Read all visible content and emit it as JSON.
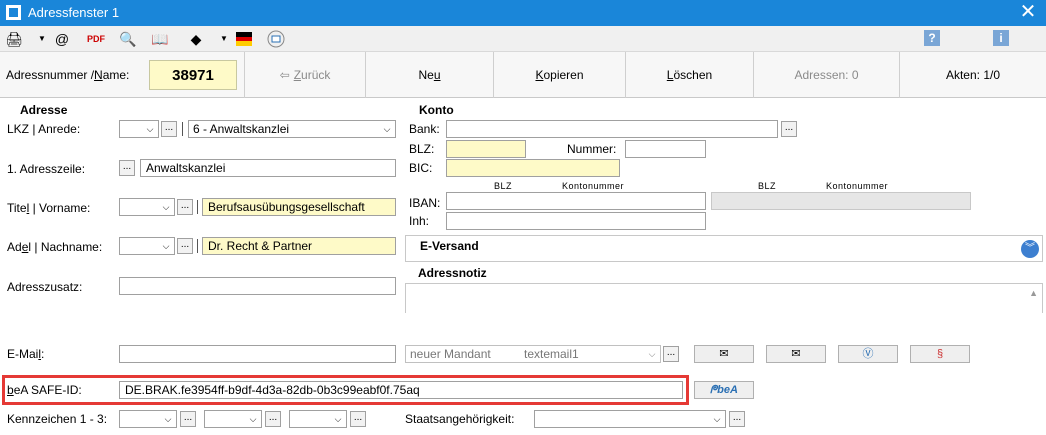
{
  "window": {
    "title": "Adressfenster 1",
    "close_glyph": "✕"
  },
  "toolbar": {
    "icons": [
      "printer-icon",
      "dropdown-icon",
      "email-at-icon",
      "pdf-icon",
      "search-icon",
      "book-icon",
      "shapes-icon",
      "german-flag-icon",
      "outlook-icon"
    ],
    "help": "?",
    "info": "i"
  },
  "actionbar": {
    "id_label_a": "Adressnummer / ",
    "id_label_b": "N",
    "id_label_c": "ame:",
    "id_value": "38971",
    "back_a": "Z",
    "back_b": "urück",
    "new_a": "Ne",
    "new_b": "u",
    "copy_a": "K",
    "copy_b": "opieren",
    "delete_a": "L",
    "delete_b": "öschen",
    "addresses": "Adressen: 0",
    "files": "Akten: 1/0"
  },
  "address": {
    "section": "Adresse",
    "lkz_label": "LKZ | Anrede:",
    "lkz_value": "",
    "anrede_value": "6   - Anwaltskanzlei",
    "line1_label": "1. Adresszeile:",
    "line1_value": "Anwaltskanzlei",
    "title_label_a": "Tite",
    "title_label_b": "l",
    "title_label_c": " | Vorname:",
    "firstname_value": "Berufsausübungsgesellschaft",
    "name_label_a": "Ad",
    "name_label_b": "e",
    "name_label_c": "l | Nachname:",
    "lastname_value": "Dr. Recht & Partner",
    "extra_label": "Adresszusatz:",
    "extra_value": ""
  },
  "konto": {
    "section": "Konto",
    "bank_label": "Bank:",
    "blz_label": "BLZ:",
    "nummer_label": "Nummer:",
    "bic_label": "BIC:",
    "blz_hint": "BLZ",
    "konto_hint": "Kontonummer",
    "blz_hint2": "BLZ",
    "konto_hint2": "Kontonummer",
    "iban_label": "IBAN:",
    "inh_label": "Inh:"
  },
  "eversand": {
    "title": "E-Versand"
  },
  "notiz": {
    "title": "Adressnotiz"
  },
  "email": {
    "label_a": "E-Mai",
    "label_b": "l",
    "label_c": ":",
    "value": "",
    "mandant_select": "neuer Mandant",
    "template": "textemail1"
  },
  "bea": {
    "label_a": "b",
    "label_b": "eA SAFE-ID:",
    "value": "DE.BRAK.fe3954ff-b9df-4d3a-82db-0b3c99eabf0f.75aq",
    "button": "beA",
    "highlight_color": "#e53935"
  },
  "kennzeichen": {
    "label": "Kennzeichen 1 - 3:",
    "staat_label": "Staatsangehörigkeit:"
  }
}
